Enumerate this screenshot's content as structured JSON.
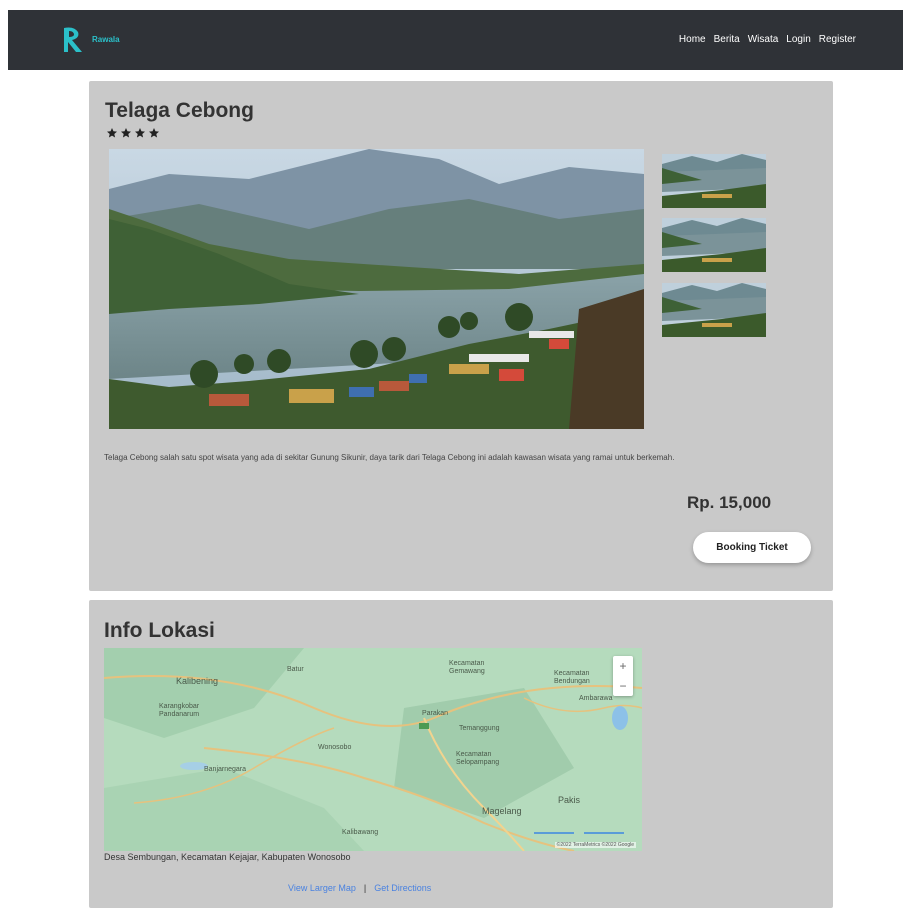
{
  "navbar": {
    "brand": "Rawala",
    "links": [
      "Home",
      "Berita",
      "Wisata",
      "Login",
      "Register"
    ]
  },
  "detail": {
    "title": "Telaga Cebong",
    "rating": 4,
    "description": "Telaga Cebong salah satu spot wisata yang ada di sekitar Gunung Sikunir, daya tarik dari Telaga Cebong ini adalah kawasan wisata yang ramai untuk berkemah.",
    "price": "Rp. 15,000",
    "booking_label": "Booking Ticket"
  },
  "location": {
    "title": "Info Lokasi",
    "address": "Desa Sembungan, Kecamatan Kejajar, Kabupaten Wonosobo",
    "map_labels": [
      "Batur",
      "Kalibening",
      "Kecamatan\nGemawang",
      "Kecamatan\nBendungan",
      "Ambarawa",
      "Karangkobar\nPandanarum",
      "Wonosobo",
      "Parakan",
      "Temanggung",
      "Kecamatan\nSelopampang",
      "Banjarnegara",
      "Magelang",
      "Pakis",
      "Kalibawang"
    ],
    "zoom_in": "+",
    "zoom_out": "−",
    "attribution": "©2022 TerraMetrics ©2022 Google",
    "view_larger": "View Larger Map",
    "separator": "|",
    "directions": "Get Directions"
  },
  "colors": {
    "navbar": "#2f3237",
    "card": "#c9c9c9",
    "brand": "#2bc0c9",
    "link": "#4a82e0"
  }
}
